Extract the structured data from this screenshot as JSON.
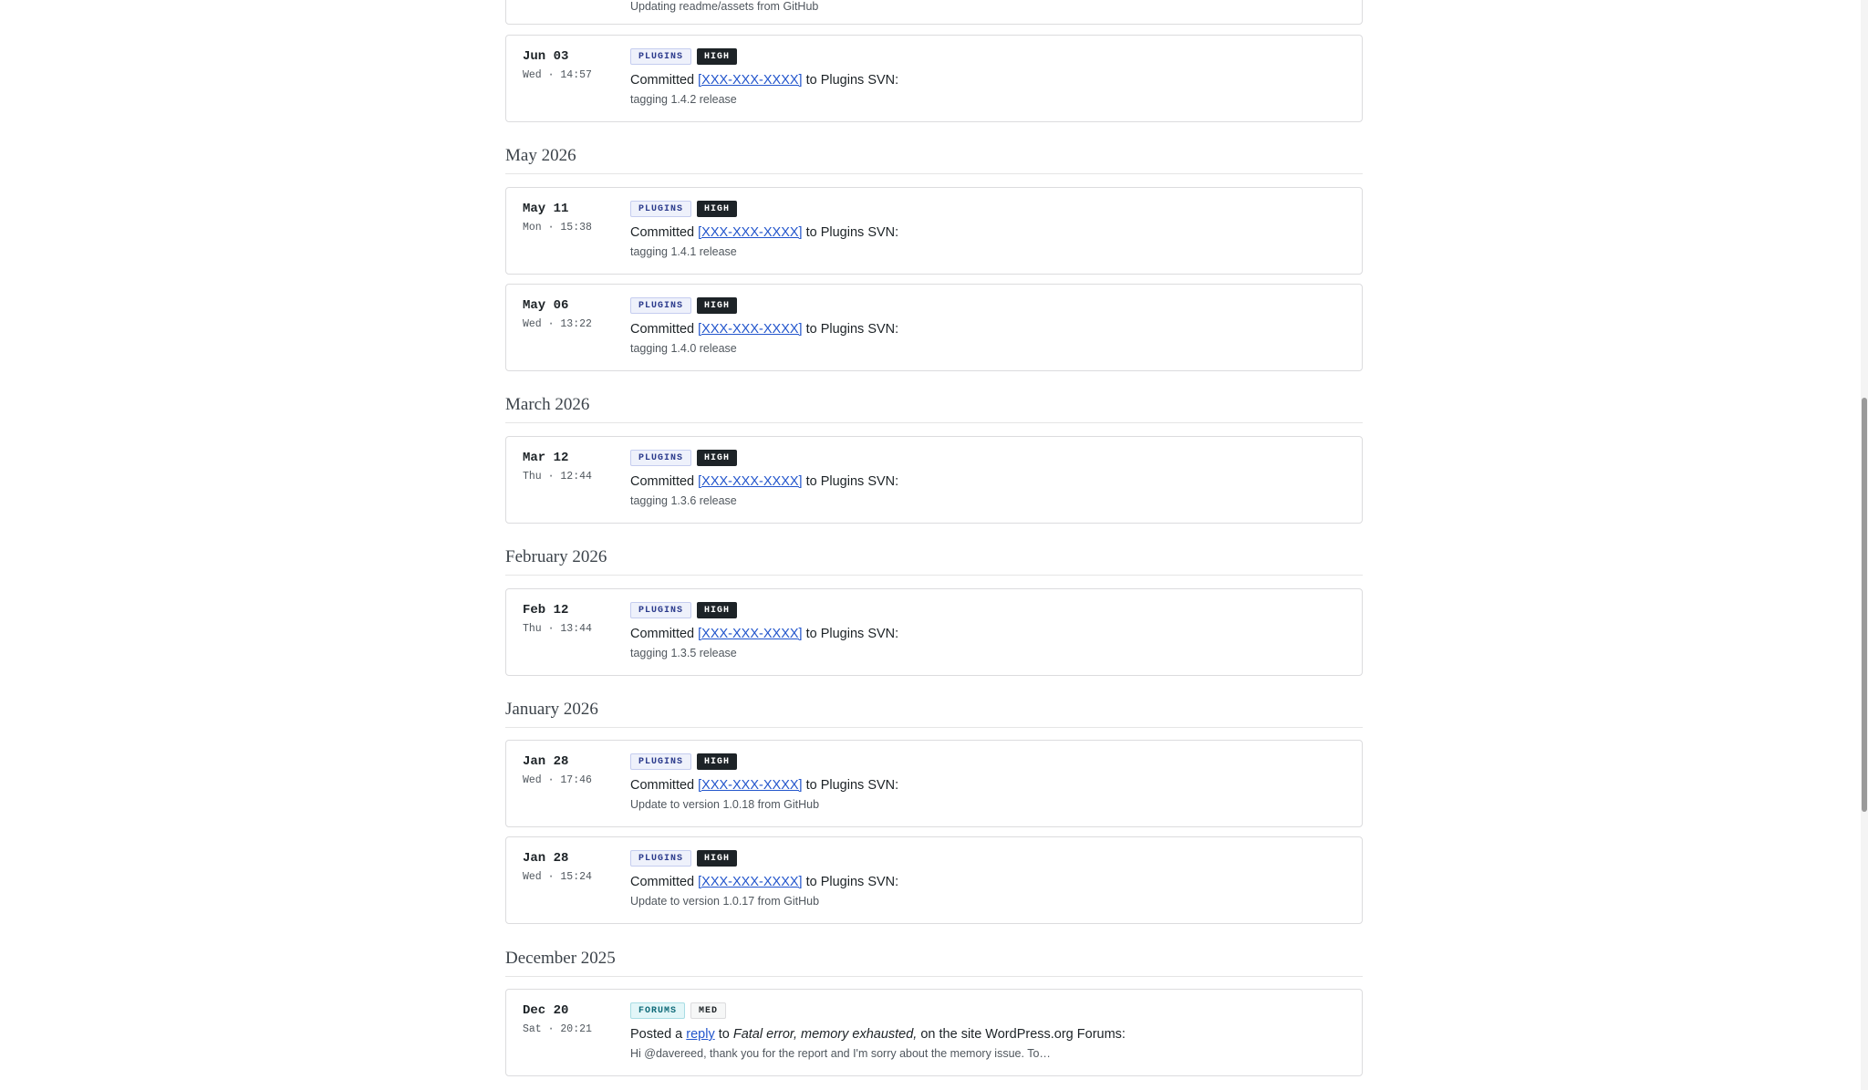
{
  "top_partial": {
    "desc": "Updating readme/assets from GitHub"
  },
  "groups": [
    {
      "month": "May 2026",
      "entries": [
        {
          "date": "May 11",
          "time": "Mon · 15:38",
          "badge_type": "PLUGINS",
          "badge_level": "HIGH",
          "prefix": "Committed ",
          "link": "[XXX-XXX-XXXX]",
          "suffix": " to Plugins SVN:",
          "desc": "tagging 1.4.1 release"
        },
        {
          "date": "May 06",
          "time": "Wed · 13:22",
          "badge_type": "PLUGINS",
          "badge_level": "HIGH",
          "prefix": "Committed ",
          "link": "[XXX-XXX-XXXX]",
          "suffix": " to Plugins SVN:",
          "desc": "tagging 1.4.0 release"
        }
      ]
    },
    {
      "month": "March 2026",
      "entries": [
        {
          "date": "Mar 12",
          "time": "Thu · 12:44",
          "badge_type": "PLUGINS",
          "badge_level": "HIGH",
          "prefix": "Committed ",
          "link": "[XXX-XXX-XXXX]",
          "suffix": " to Plugins SVN:",
          "desc": "tagging 1.3.6 release"
        }
      ]
    },
    {
      "month": "February 2026",
      "entries": [
        {
          "date": "Feb 12",
          "time": "Thu · 13:44",
          "badge_type": "PLUGINS",
          "badge_level": "HIGH",
          "prefix": "Committed ",
          "link": "[XXX-XXX-XXXX]",
          "suffix": " to Plugins SVN:",
          "desc": "tagging 1.3.5 release"
        }
      ]
    },
    {
      "month": "January 2026",
      "entries": [
        {
          "date": "Jan 28",
          "time": "Wed · 17:46",
          "badge_type": "PLUGINS",
          "badge_level": "HIGH",
          "prefix": "Committed ",
          "link": "[XXX-XXX-XXXX]",
          "suffix": " to Plugins SVN:",
          "desc": "Update to version 1.0.18 from GitHub"
        },
        {
          "date": "Jan 28",
          "time": "Wed · 15:24",
          "badge_type": "PLUGINS",
          "badge_level": "HIGH",
          "prefix": "Committed ",
          "link": "[XXX-XXX-XXXX]",
          "suffix": " to Plugins SVN:",
          "desc": "Update to version 1.0.17 from GitHub"
        }
      ]
    },
    {
      "month": "December 2025",
      "entries": [
        {
          "date": "Dec 20",
          "time": "Sat · 20:21",
          "badge_type": "FORUMS",
          "badge_level": "MED",
          "prefix": "Posted a ",
          "link": "reply",
          "middle": " to ",
          "topic": "Fatal error, memory exhausted,",
          "suffix": " on the site WordPress.org Forums:",
          "desc": "Hi @davereed, thank you for the report and I'm sorry about the memory issue. To…"
        }
      ]
    }
  ],
  "first_entry": {
    "date": "Jun 03",
    "time": "Wed · 14:57",
    "badge_type": "PLUGINS",
    "badge_level": "HIGH",
    "prefix": "Committed ",
    "link": "[XXX-XXX-XXXX]",
    "suffix": " to Plugins SVN:",
    "desc": "tagging 1.4.2 release"
  }
}
